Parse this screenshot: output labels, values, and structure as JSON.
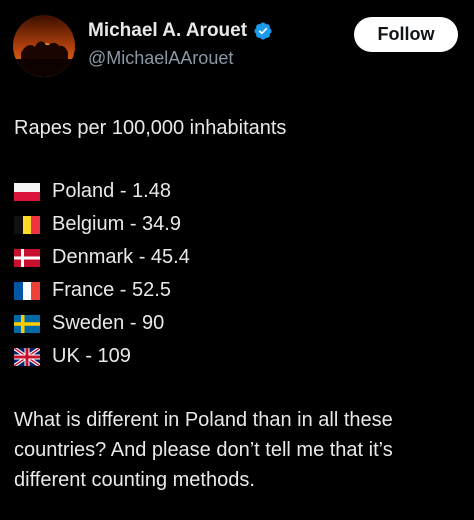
{
  "author": {
    "display_name": "Michael A. Arouet",
    "handle": "@MichaelAArouet",
    "verified": true,
    "avatar": "sunset-silhouette-avatar"
  },
  "follow_button": {
    "label": "Follow"
  },
  "tweet": {
    "title": "Rapes per 100,000 inhabitants",
    "stats": [
      {
        "flag_icon": "poland-flag-icon",
        "text": "Poland - 1.48"
      },
      {
        "flag_icon": "belgium-flag-icon",
        "text": "Belgium - 34.9"
      },
      {
        "flag_icon": "denmark-flag-icon",
        "text": "Denmark - 45.4"
      },
      {
        "flag_icon": "france-flag-icon",
        "text": "France - 52.5"
      },
      {
        "flag_icon": "sweden-flag-icon",
        "text": "Sweden - 90"
      },
      {
        "flag_icon": "uk-flag-icon",
        "text": "UK - 109"
      }
    ],
    "question": "What is different in Poland than in all these countries? And please don’t tell me that it’s different counting methods."
  },
  "colors": {
    "background": "#000000",
    "text_primary": "#e7e9ea",
    "text_secondary": "#8b98a5",
    "verified_blue": "#1d9bf0",
    "button_bg": "#ffffff",
    "button_text": "#0f1419"
  }
}
